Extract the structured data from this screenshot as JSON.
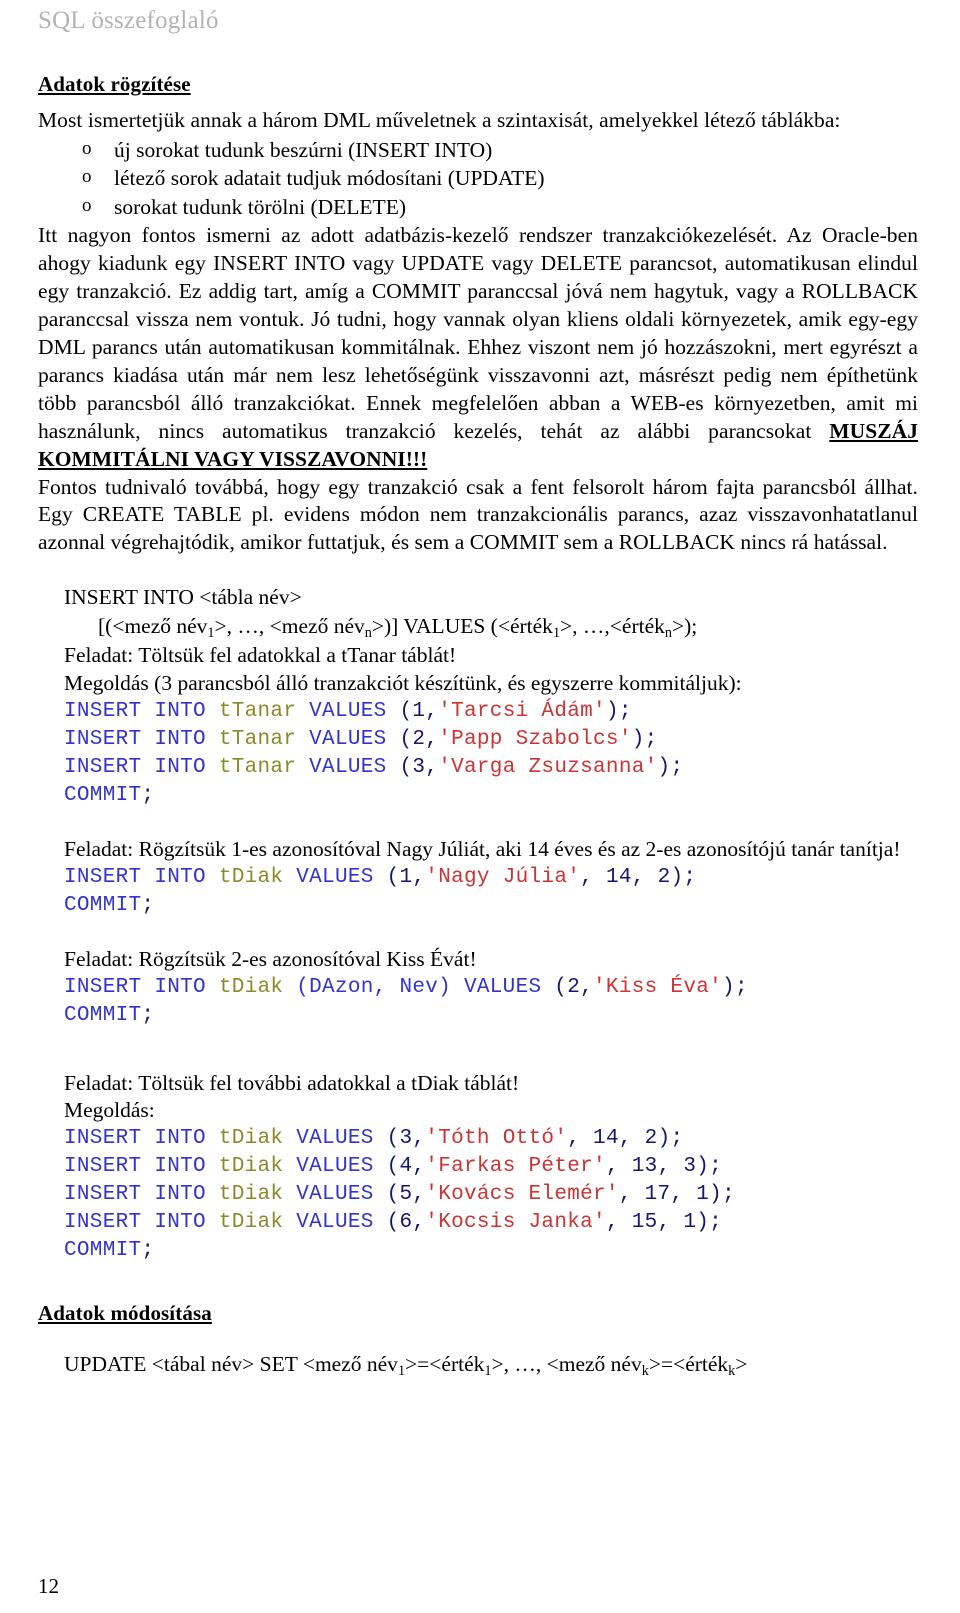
{
  "header": {
    "running_title": "SQL összefoglaló"
  },
  "sections": [
    {
      "heading": "Adatok rögzítése"
    },
    {
      "heading": "Adatok módosítása"
    }
  ],
  "intro": {
    "lead": "Most ismertetjük annak a három DML műveletnek a szintaxisát, amelyekkel létező táblákba:",
    "bullets": [
      "új sorokat tudunk beszúrni (INSERT INTO)",
      "létező sorok adatait tudjuk módosítani (UPDATE)",
      "sorokat tudunk törölni (DELETE)"
    ]
  },
  "body": {
    "p1_part1": "Itt nagyon fontos ismerni az adott adatbázis-kezelő rendszer tranzakciókezelését. Az Oracle-ben ahogy kiadunk egy INSERT INTO vagy UPDATE vagy DELETE parancsot, automatikusan elindul egy tranzakció. Ez addig tart, amíg a COMMIT paranccsal jóvá nem hagytuk, vagy a ROLLBACK paranccsal vissza nem vontuk. Jó tudni, hogy vannak olyan kliens oldali környezetek, amik egy-egy DML parancs után automatikusan kommitálnak. Ehhez viszont nem jó hozzászokni, mert egyrészt a parancs kiadása után már nem lesz lehetőségünk visszavonni azt, másrészt pedig nem építhetünk több parancsból álló tranzakciókat. Ennek megfelelően abban a WEB-es környezetben, amit mi használunk, nincs automatikus tranzakció kezelés, tehát az alábbi parancsokat ",
    "p1_emphasis": "MUSZÁJ KOMMITÁLNI VAGY VISSZAVONNI!!!",
    "p2": "Fontos tudnivaló továbbá, hogy egy tranzakció csak a fent felsorolt három fajta parancsból állhat. Egy CREATE TABLE pl. evidens módon nem tranzakcionális parancs, azaz visszavonhatatlanul azonnal végrehajtódik, amikor futtatjuk, és sem a COMMIT sem a ROLLBACK nincs rá hatással."
  },
  "insert_syntax": {
    "line1": "INSERT INTO <tábla név>",
    "line2_pre": "[(<mező név",
    "line2_sub1": "1",
    "line2_mid": ">, …, <mező név",
    "line2_sub2": "n",
    "line2_mid2": ">)] VALUES (<érték",
    "line2_sub3": "1",
    "line2_mid3": ">, …,<érték",
    "line2_sub4": "n",
    "line2_end": ">);"
  },
  "tasks": {
    "t1_feladat": "Feladat: Töltsük fel adatokkal a tTanar táblát!",
    "t1_megoldas": "Megoldás (3 parancsból álló tranzakciót készítünk, és egyszerre kommitáljuk):",
    "t2_feladat": "Feladat: Rögzítsük 1-es azonosítóval Nagy Júliát, aki 14 éves és az 2-es azonosítójú tanár tanítja!",
    "t3_feladat": "Feladat: Rögzítsük 2-es azonosítóval Kiss Évát!",
    "t4_feladat": "Feladat: Töltsük fel további adatokkal a tDiak táblát!",
    "t4_megoldas": "Megoldás:"
  },
  "code": {
    "block1": [
      {
        "kw": "INSERT INTO ",
        "tbl": "tTanar ",
        "kw2": "VALUES ",
        "punc": "(",
        "num": "1",
        "punc2": ",",
        "str": "'Tarcsi Ádám'",
        "punc3": ");"
      },
      {
        "kw": "INSERT INTO ",
        "tbl": "tTanar ",
        "kw2": "VALUES ",
        "punc": "(",
        "num": "2",
        "punc2": ",",
        "str": "'Papp Szabolcs'",
        "punc3": ");"
      },
      {
        "kw": "INSERT INTO ",
        "tbl": "tTanar ",
        "kw2": "VALUES ",
        "punc": "(",
        "num": "3",
        "punc2": ",",
        "str": "'Varga Zsuzsanna'",
        "punc3": ");"
      }
    ],
    "commit_kw": "COMMIT",
    "commit_punc": ";",
    "block2": [
      {
        "kw": "INSERT INTO ",
        "tbl": "tDiak ",
        "kw2": "VALUES ",
        "punc": "(",
        "num": "1",
        "punc2": ",",
        "str": "'Nagy Júlia'",
        "punc3": ", ",
        "num2": "14",
        "punc4": ", ",
        "num3": "2",
        "punc5": ");"
      }
    ],
    "block3_kw": "INSERT INTO ",
    "block3_tbl": "tDiak ",
    "block3_cols": "(DAzon, Nev)",
    "block3_values": " VALUES ",
    "block3_punc": "(",
    "block3_num": "2",
    "block3_comma": ",",
    "block3_str": "'Kiss Éva'",
    "block3_end": ");",
    "block4": [
      {
        "kw": "INSERT INTO ",
        "tbl": "tDiak ",
        "kw2": "VALUES ",
        "punc": "(",
        "num": "3",
        "punc2": ",",
        "str": "'Tóth Ottó'",
        "punc3": ", ",
        "num2": "14",
        "punc4": ", ",
        "num3": "2",
        "punc5": ");"
      },
      {
        "kw": "INSERT INTO ",
        "tbl": "tDiak ",
        "kw2": "VALUES ",
        "punc": "(",
        "num": "4",
        "punc2": ",",
        "str": "'Farkas Péter'",
        "punc3": ", ",
        "num2": "13",
        "punc4": ", ",
        "num3": "3",
        "punc5": ");"
      },
      {
        "kw": "INSERT INTO ",
        "tbl": "tDiak ",
        "kw2": "VALUES ",
        "punc": "(",
        "num": "5",
        "punc2": ",",
        "str": "'Kovács Elemér'",
        "punc3": ", ",
        "num2": "17",
        "punc4": ", ",
        "num3": "1",
        "punc5": ");"
      },
      {
        "kw": "INSERT INTO ",
        "tbl": "tDiak ",
        "kw2": "VALUES ",
        "punc": "(",
        "num": "6",
        "punc2": ",",
        "str": "'Kocsis Janka'",
        "punc3": ", ",
        "num2": "15",
        "punc4": ", ",
        "num3": "1",
        "punc5": ");"
      }
    ]
  },
  "update_syntax": {
    "pre": "UPDATE <tábal név> SET <mező név",
    "sub1": "1",
    "mid": ">=<érték",
    "sub2": "1",
    "mid2": ">, …, <mező név",
    "sub3": "k",
    "mid3": ">=<érték",
    "sub4": "k",
    "end": ">"
  },
  "footer": {
    "page_number": "12"
  },
  "colors": {
    "keyword": "#3333cc",
    "table": "#8a8a2b",
    "string": "#cc3333",
    "punctuation": "#16166e",
    "header_gray": "#b3b3b3"
  }
}
